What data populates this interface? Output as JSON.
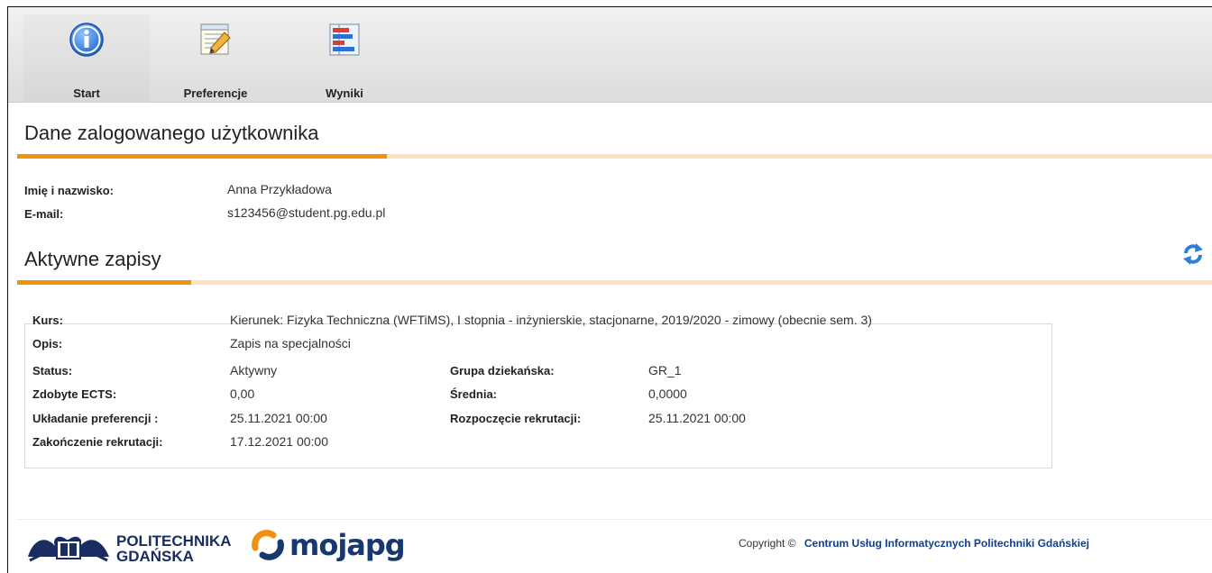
{
  "toolbar": {
    "tabs": [
      {
        "label": "Start",
        "icon": "info-icon",
        "active": true
      },
      {
        "label": "Preferencje",
        "icon": "edit-list-icon",
        "active": false
      },
      {
        "label": "Wyniki",
        "icon": "results-chart-icon",
        "active": false
      }
    ]
  },
  "user_section": {
    "title": "Dane zalogowanego użytkownika",
    "name_label": "Imię i nazwisko:",
    "name_value": "Anna Przykładowa",
    "email_label": "E-mail:",
    "email_value": "s123456@student.pg.edu.pl"
  },
  "enrollment_section": {
    "title": "Aktywne zapisy",
    "refresh_icon": "refresh-icon",
    "kurs_label": "Kurs:",
    "kurs_value": "Kierunek: Fizyka Techniczna (WFTiMS), I stopnia - inżynierskie, stacjonarne, 2019/2020  - zimowy (obecnie sem. 3)",
    "opis_label": "Opis:",
    "opis_value": "Zapis na specjalności",
    "status_label": "Status:",
    "status_value": "Aktywny",
    "grupa_label": "Grupa dziekańska:",
    "grupa_value": "GR_1",
    "ects_label": "Zdobyte ECTS:",
    "ects_value": "0,00",
    "srednia_label": "Średnia:",
    "srednia_value": "0,0000",
    "ukladanie_label": "Układanie preferencji :",
    "ukladanie_value": "25.11.2021 00:00",
    "rozpoczecie_label": "Rozpoczęcie rekrutacji:",
    "rozpoczecie_value": "25.11.2021 00:00",
    "zakonczenie_label": "Zakończenie rekrutacji:",
    "zakonczenie_value": "17.12.2021 00:00"
  },
  "footer": {
    "pg_logo_line1": "POLITECHNIKA",
    "pg_logo_line2": "GDAŃSKA",
    "moja_logo": "mojapg",
    "copyright_text": "Copyright ©",
    "copyright_link": "Centrum Usług Informatycznych Politechniki Gdańskiej"
  },
  "colors": {
    "accent_orange": "#f0920a",
    "accent_light": "#fbe3c0",
    "link_blue": "#0e3f8f"
  }
}
